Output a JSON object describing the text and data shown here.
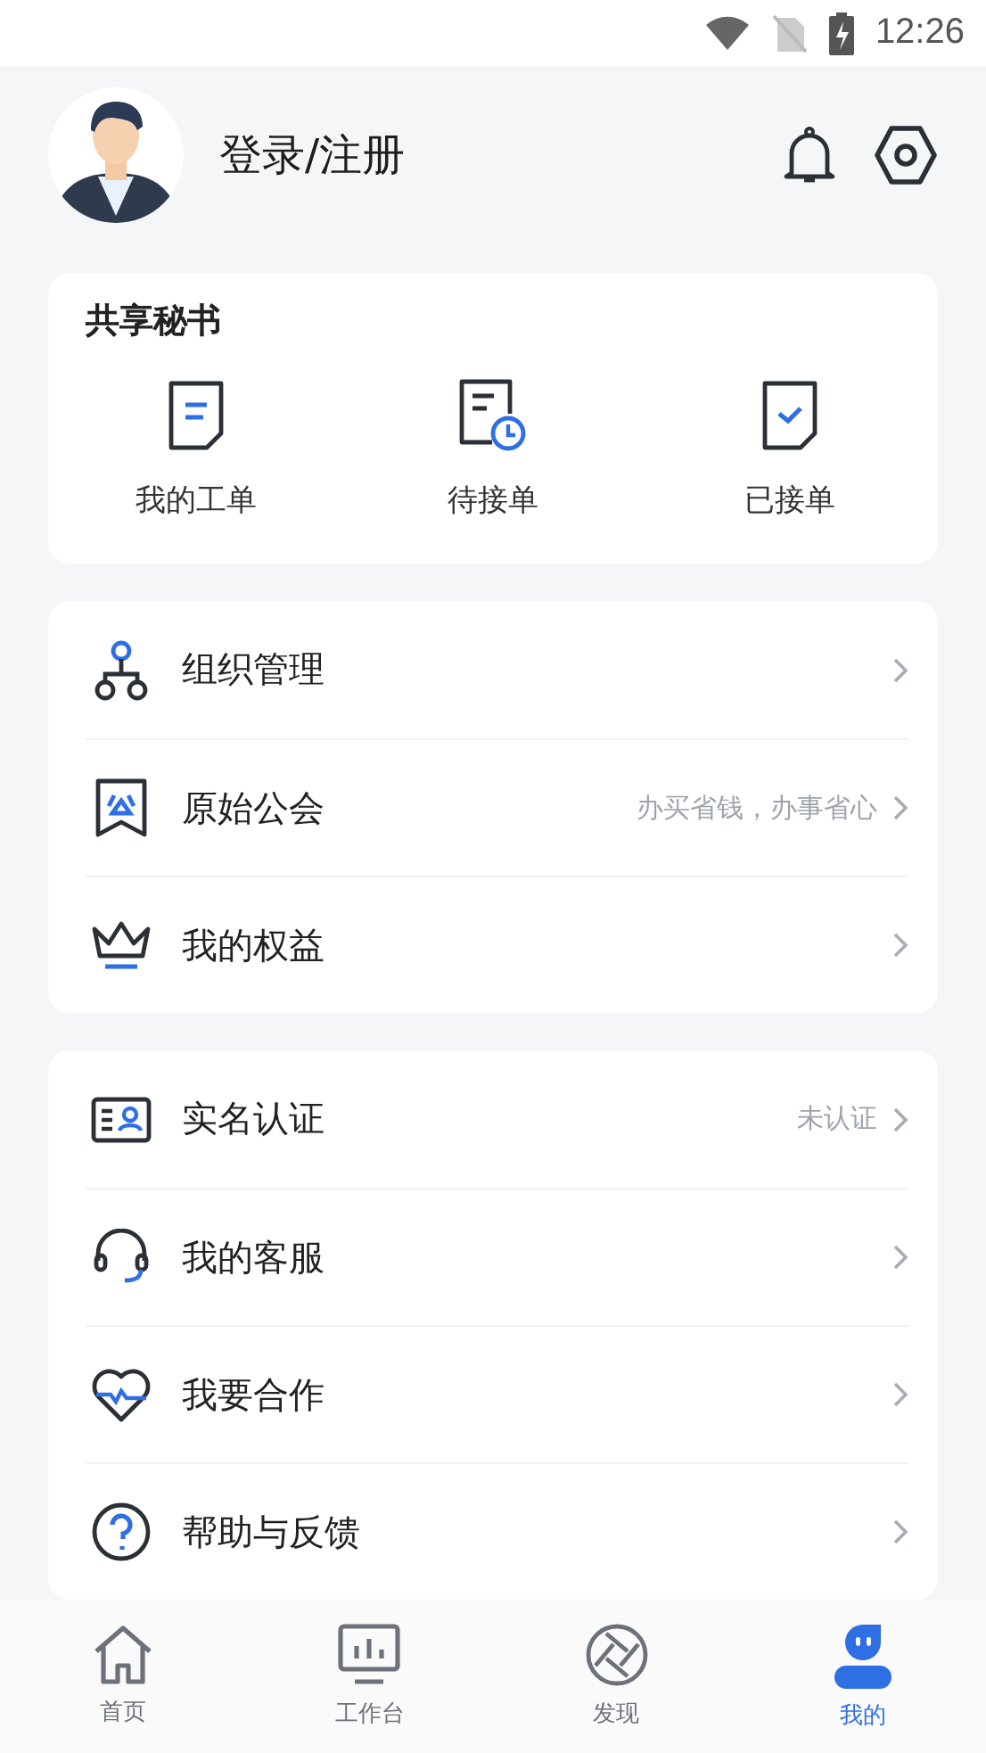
{
  "status_bar": {
    "time": "12:26"
  },
  "profile": {
    "login_label": "登录/注册"
  },
  "secretary": {
    "title": "共享秘书",
    "items": [
      {
        "kind": "orders",
        "label": "我的工单"
      },
      {
        "kind": "pending",
        "label": "待接单"
      },
      {
        "kind": "accepted",
        "label": "已接单"
      }
    ]
  },
  "menu_groups": [
    {
      "items": [
        {
          "kind": "org",
          "label": "组织管理"
        },
        {
          "kind": "union",
          "label": "原始公会",
          "hint": "办买省钱，办事省心"
        },
        {
          "kind": "crown",
          "label": "我的权益"
        }
      ]
    },
    {
      "items": [
        {
          "kind": "id",
          "label": "实名认证",
          "hint": "未认证"
        },
        {
          "kind": "headset",
          "label": "我的客服"
        },
        {
          "kind": "heart",
          "label": "我要合作"
        },
        {
          "kind": "help",
          "label": "帮助与反馈"
        }
      ]
    }
  ],
  "tab_bar": [
    {
      "kind": "home",
      "label": "首页",
      "selected": false
    },
    {
      "kind": "desk",
      "label": "工作台",
      "selected": false
    },
    {
      "kind": "discover",
      "label": "发现",
      "selected": false
    },
    {
      "kind": "me",
      "label": "我的",
      "selected": true
    }
  ]
}
